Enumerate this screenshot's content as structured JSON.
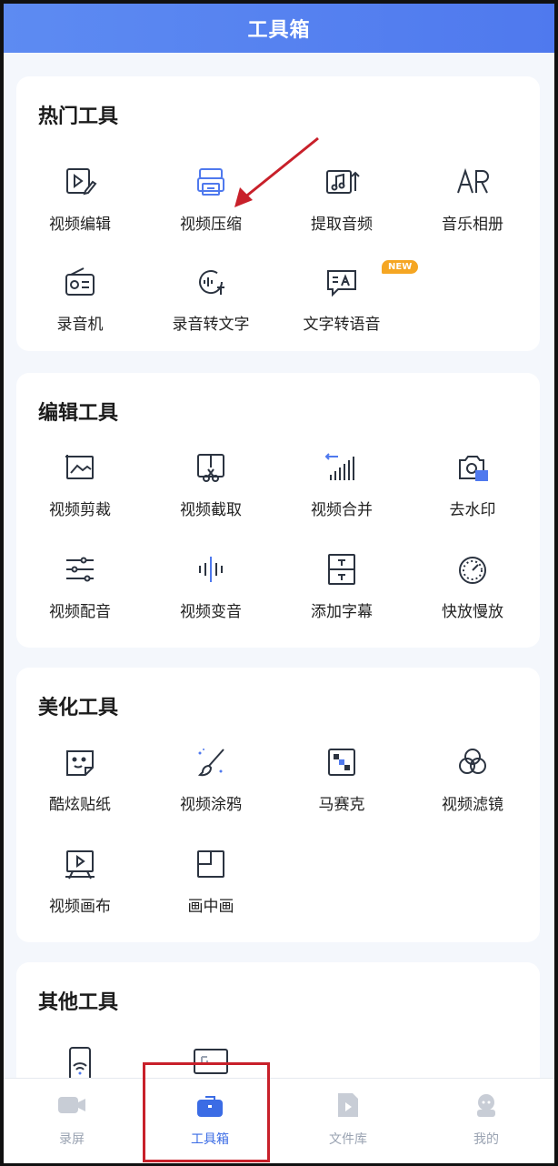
{
  "header": {
    "title": "工具箱"
  },
  "sections": {
    "hot": {
      "title": "热门工具",
      "items": [
        {
          "label": "视频编辑",
          "icon": "video-edit-icon"
        },
        {
          "label": "视频压缩",
          "icon": "video-compress-icon"
        },
        {
          "label": "提取音频",
          "icon": "extract-audio-icon"
        },
        {
          "label": "音乐相册",
          "icon": "music-album-icon"
        },
        {
          "label": "录音机",
          "icon": "radio-recorder-icon"
        },
        {
          "label": "录音转文字",
          "icon": "voice-to-text-icon"
        },
        {
          "label": "文字转语音",
          "icon": "text-to-speech-icon"
        }
      ],
      "badge": "NEW"
    },
    "edit": {
      "title": "编辑工具",
      "items": [
        {
          "label": "视频剪裁",
          "icon": "crop-icon"
        },
        {
          "label": "视频截取",
          "icon": "clip-icon"
        },
        {
          "label": "视频合并",
          "icon": "merge-icon"
        },
        {
          "label": "去水印",
          "icon": "remove-watermark-icon"
        },
        {
          "label": "视频配音",
          "icon": "dubbing-icon"
        },
        {
          "label": "视频变音",
          "icon": "voice-change-icon"
        },
        {
          "label": "添加字幕",
          "icon": "subtitle-icon"
        },
        {
          "label": "快放慢放",
          "icon": "speed-icon"
        }
      ]
    },
    "beauty": {
      "title": "美化工具",
      "items": [
        {
          "label": "酷炫贴纸",
          "icon": "sticker-icon"
        },
        {
          "label": "视频涂鸦",
          "icon": "brush-icon"
        },
        {
          "label": "马赛克",
          "icon": "mosaic-icon"
        },
        {
          "label": "视频滤镜",
          "icon": "filter-icon"
        },
        {
          "label": "视频画布",
          "icon": "canvas-icon"
        },
        {
          "label": "画中画",
          "icon": "pip-icon"
        }
      ]
    },
    "other": {
      "title": "其他工具",
      "items": [
        {
          "icon": "wifi-transfer-icon"
        },
        {
          "icon": "gif-icon"
        }
      ]
    }
  },
  "tabbar": {
    "items": [
      {
        "label": "录屏",
        "icon": "video-camera-icon"
      },
      {
        "label": "工具箱",
        "icon": "toolbox-icon"
      },
      {
        "label": "文件库",
        "icon": "file-library-icon"
      },
      {
        "label": "我的",
        "icon": "profile-icon"
      }
    ],
    "active_index": 1
  },
  "colors": {
    "accent": "#4f79ee",
    "highlight": "#c8202a",
    "icon": "#2b3340",
    "badge": "#f5a623"
  }
}
